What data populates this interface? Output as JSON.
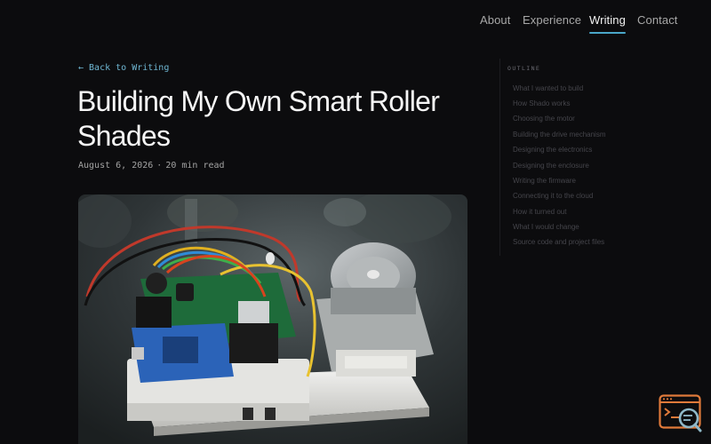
{
  "nav": {
    "items": [
      {
        "label": "About",
        "active": false
      },
      {
        "label": "Experience",
        "active": false
      },
      {
        "label": "Writing",
        "active": true
      },
      {
        "label": "Contact",
        "active": false
      }
    ],
    "accent_color": "#4aa7c9"
  },
  "article": {
    "back_label": "← Back to Writing",
    "title": "Building My Own Smart Roller Shades",
    "date": "August 6, 2026",
    "separator": "·",
    "read_time": "20 min read",
    "hero_image": "photo of a DIY smart shade controller: microcontroller board, motor driver, stepper motor with gear on a white 3D-printed base"
  },
  "outline": {
    "heading": "OUTLINE",
    "items": [
      "What I wanted to build",
      "How Shado works",
      "Choosing the motor",
      "Building the drive mechanism",
      "Designing the electronics",
      "Designing the enclosure",
      "Writing the firmware",
      "Connecting it to the cloud",
      "How it turned out",
      "What I would change",
      "Source code and project files"
    ]
  },
  "widget": {
    "icon": "terminal-search-icon",
    "color": "#e07a3a"
  }
}
